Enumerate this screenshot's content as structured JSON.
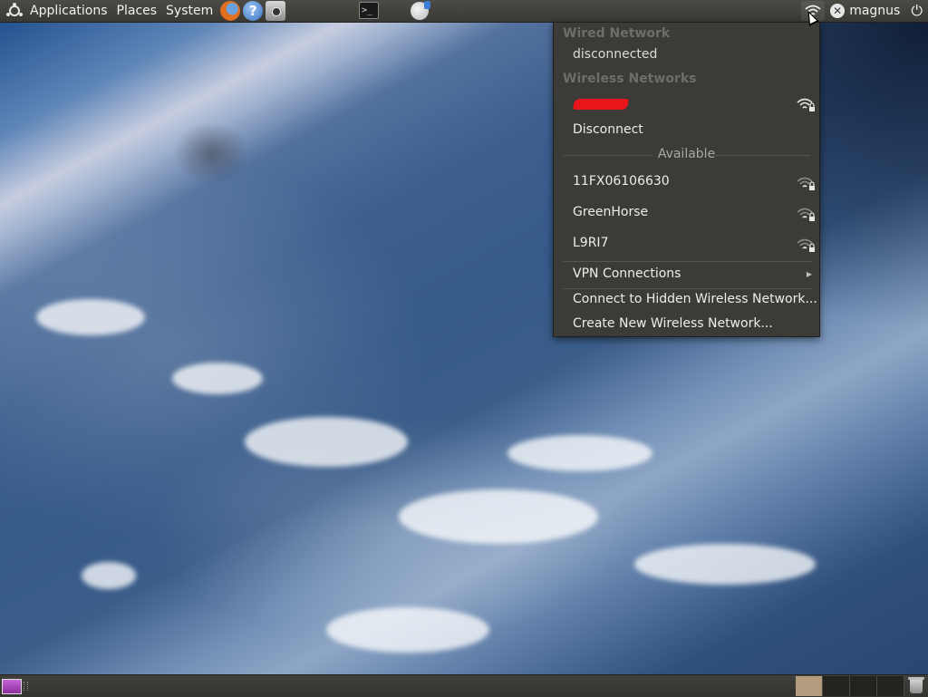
{
  "top_panel": {
    "menus": [
      "Applications",
      "Places",
      "System"
    ],
    "launchers": [
      "firefox-icon",
      "help-icon",
      "screenshot-icon"
    ],
    "tasks": [
      "terminal-icon",
      "update-manager-icon"
    ],
    "user_name": "magnus",
    "terminal_glyph": ">_"
  },
  "network_menu": {
    "wired_header": "Wired Network",
    "wired_status": "disconnected",
    "wireless_header": "Wireless Networks",
    "disconnect_label": "Disconnect",
    "available_label": "Available",
    "networks": [
      {
        "ssid": "11FX06106630",
        "secured": true
      },
      {
        "ssid": "GreenHorse",
        "secured": true
      },
      {
        "ssid": "L9RI7",
        "secured": true
      }
    ],
    "vpn_label": "VPN Connections",
    "hidden_label": "Connect to Hidden Wireless Network...",
    "create_label": "Create New Wireless Network..."
  },
  "bottom_panel": {
    "workspaces": 4,
    "active_workspace": 1
  },
  "colors": {
    "panel": "#3c3b37",
    "menu_bg": "#3c3b37",
    "header_text": "#6e6d69",
    "workspace_active": "#b29c7d",
    "redaction": "#e8161a"
  }
}
